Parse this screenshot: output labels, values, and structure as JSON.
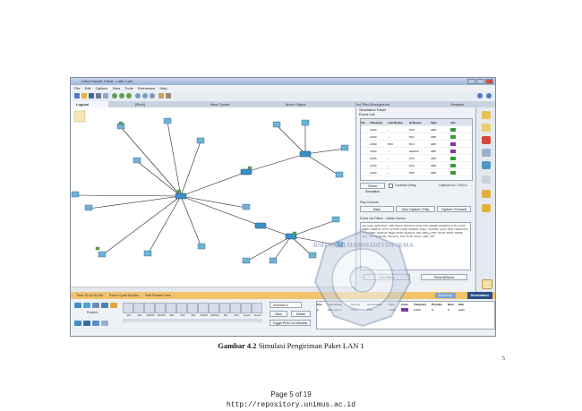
{
  "window": {
    "title": "Cisco Packet Tracer - LAN 1.pkt"
  },
  "menu": [
    "File",
    "Edit",
    "Options",
    "View",
    "Tools",
    "Extensions",
    "Help"
  ],
  "tabs": [
    "Logical",
    "[Root]",
    "New Cluster",
    "Move Object",
    "Set Tiled Background",
    "Viewport"
  ],
  "side_panel": {
    "title": "Simulation Panel",
    "event_list_label": "Event List",
    "columns": [
      "Vis.",
      "Time(sec)",
      "Last Device",
      "At Device",
      "Type",
      "Info"
    ],
    "events": [
      {
        "time": "2.003",
        "last": "--",
        "at": "PC0",
        "type": "ARP",
        "color": "#3a9a3a"
      },
      {
        "time": "2.003",
        "last": "--",
        "at": "PC1",
        "type": "ARP",
        "color": "#3a9a3a"
      },
      {
        "time": "2.003",
        "last": "PC0",
        "at": "PC1",
        "type": "ARP",
        "color": "#7a3aa8"
      },
      {
        "time": "2.004",
        "last": "--",
        "at": "Switch0",
        "type": "ARP",
        "color": "#7a3aa8"
      },
      {
        "time": "2.004",
        "last": "--",
        "at": "PC3",
        "type": "ARP",
        "color": "#3a9a3a"
      },
      {
        "time": "2.004",
        "last": "--",
        "at": "PC4",
        "type": "ARP",
        "color": "#3a9a3a"
      },
      {
        "time": "2.004",
        "last": "--",
        "at": "PC5",
        "type": "ARP",
        "color": "#3a9a3a"
      }
    ],
    "reset_label": "Reset Simulation",
    "constant_delay_label": "Constant Delay",
    "captured_label": "Captured to: 2.004 s",
    "play_controls_title": "Play Controls",
    "back_label": "Back",
    "auto_capture_label": "Auto Capture / Play",
    "capture_forward_label": "Capture / Forward",
    "event_filters_label": "Event List Filters - Visible Events",
    "filter_text": "ACL Filter, ARP, BGP, CDP, DHCP, DHCPv6, DNS, DTP, EIGRP, EIGRPv6, FTP, H.323, HSRP, HSRPv6, HTTP, HTTPS, ICMP, ICMPv6, IPSec, ISAKMP, LACP, NDP, NETFLOW, NTP, OSPF, OSPFv6, PAgP, POP3, RADIUS, RIP, RIPng, RTP, SCCP, SMTP, SNMP, SSH, STP, SYSLOG, TACACS, TCP, TFTP, Telnet, UDP, VTP",
    "edit_filters_label": "Edit Filters",
    "show_all_label": "Show All/None"
  },
  "statusbar": {
    "time_label": "Time: 00:14:35.098",
    "power_cycle_label": "Power Cycle Devices",
    "fast_forward_label": "Fast Forward Time",
    "event_list_label": "Event List",
    "mode_label": "Simulation"
  },
  "bottom": {
    "category_label": "Routers",
    "scenario_label": "Scenario 0",
    "new_label": "New",
    "delete_label": "Delete",
    "toggle_label": "Toggle PDU List Window",
    "pdu_columns": [
      "Fire",
      "Last Status",
      "Source",
      "Destination",
      "Type",
      "Color",
      "Time(sec)",
      "Periodic",
      "Num",
      "Edit"
    ],
    "pdu_row": [
      "●",
      "In Progress",
      "PC0",
      "PC9",
      "ICMP",
      "",
      "0.000",
      "N",
      "0",
      "(edit)"
    ],
    "device_labels": [
      "1841",
      "1941",
      "2620XM",
      "2621XM",
      "2811",
      "2901",
      "2911",
      "819IOX",
      "819HGW",
      "829",
      "1240",
      "Generic",
      "Generic"
    ]
  },
  "caption": {
    "bold": "Gambar 4.2",
    "text": " Simulasi Pengiriman Paket LAN 1"
  },
  "page_mark": "5",
  "footer": {
    "page": "Page 5 of 19",
    "url": "http://repository.unimus.ac.id"
  },
  "watermark_text": "UNIVERSITAS MUHAMMADIYAH SEMARANG"
}
